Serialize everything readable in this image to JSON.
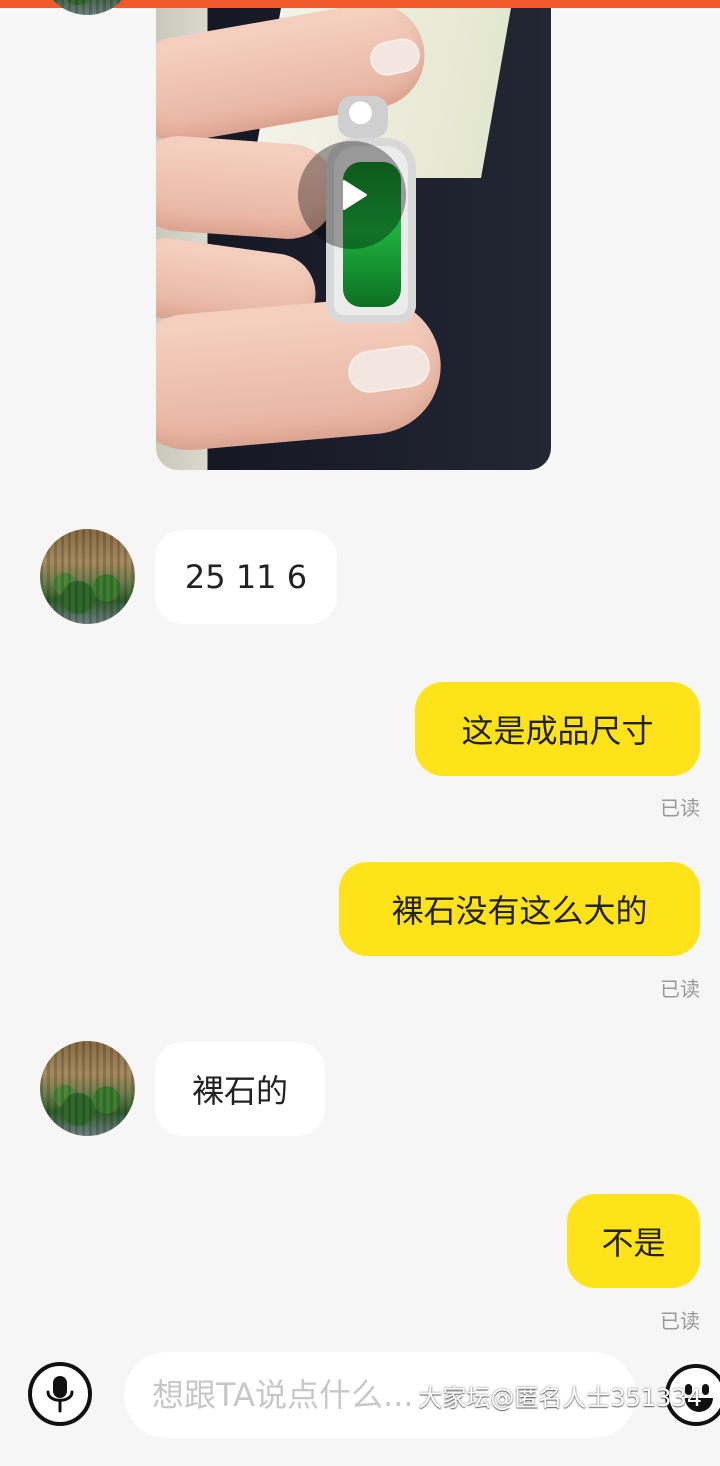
{
  "chat": {
    "messages": [
      {
        "type": "video",
        "side": "left"
      },
      {
        "type": "text",
        "side": "left",
        "text": "25 11 6"
      },
      {
        "type": "text",
        "side": "right",
        "text": "这是成品尺寸",
        "status": "已读"
      },
      {
        "type": "text",
        "side": "right",
        "text": "裸石没有这么大的",
        "status": "已读"
      },
      {
        "type": "text",
        "side": "left",
        "text": "裸石的"
      },
      {
        "type": "text",
        "side": "right",
        "text": "不是",
        "status": "已读"
      }
    ]
  },
  "composer": {
    "placeholder": "想跟TA说点什么..."
  },
  "watermark": "大家坛@匿名人士351334",
  "colors": {
    "top_accent": "#f15a2b",
    "my_bubble": "#ffe31a",
    "their_bubble": "#ffffff",
    "background": "#f6f6f6"
  },
  "icons": {
    "video_play": "play-icon",
    "voice": "microphone-icon",
    "emoji": "emoji-icon"
  }
}
